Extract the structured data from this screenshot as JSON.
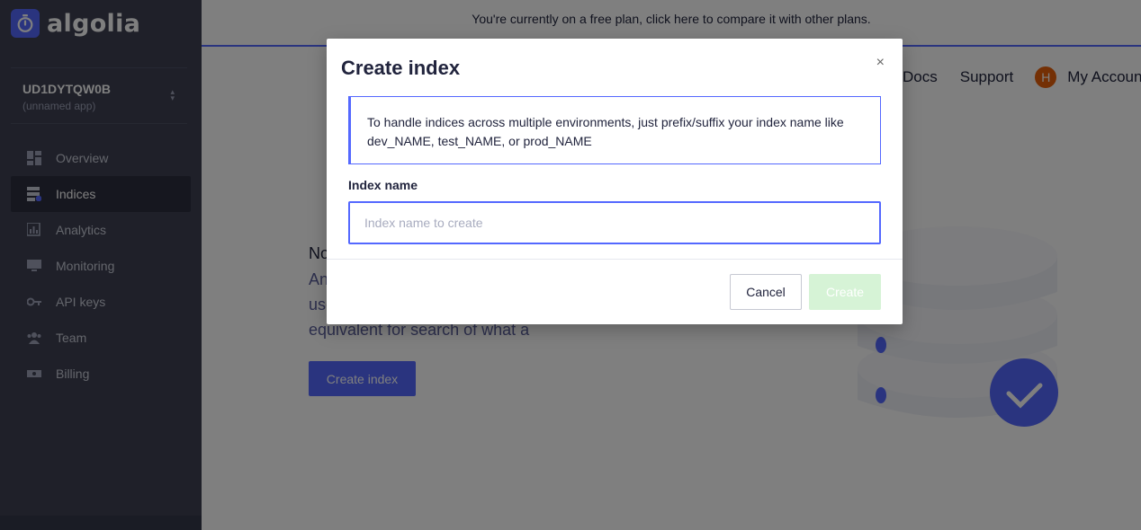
{
  "brand": {
    "name": "algolia",
    "accent": "#5468ff"
  },
  "banner": {
    "text": "You're currently on a free plan, click here to compare it with other plans."
  },
  "app": {
    "id": "UD1DYTQW0B",
    "name": "(unnamed app)"
  },
  "sidebar": {
    "items": [
      {
        "label": "Overview",
        "icon": "dashboard-icon",
        "active": false
      },
      {
        "label": "Indices",
        "icon": "indices-icon",
        "active": true
      },
      {
        "label": "Analytics",
        "icon": "analytics-icon",
        "active": false
      },
      {
        "label": "Monitoring",
        "icon": "monitor-icon",
        "active": false
      },
      {
        "label": "API keys",
        "icon": "key-icon",
        "active": false
      },
      {
        "label": "Team",
        "icon": "team-icon",
        "active": false
      },
      {
        "label": "Billing",
        "icon": "billing-icon",
        "active": false
      }
    ]
  },
  "topnav": {
    "docs": "Docs",
    "support": "Support",
    "avatar_initial": "H",
    "account": "My Account"
  },
  "empty_state": {
    "title": "No",
    "description": "An index is the place where the data used by Algolia is stored. It is the equivalent for search of what a database is for storage. It is what you send queries against (search).",
    "button": "Create index"
  },
  "modal": {
    "title": "Create index",
    "close": "×",
    "info": "To handle indices across multiple environments, just prefix/suffix your index name like dev_NAME, test_NAME, or prod_NAME",
    "field_label": "Index name",
    "field_placeholder": "Index name to create",
    "field_value": "",
    "cancel": "Cancel",
    "create": "Create"
  }
}
